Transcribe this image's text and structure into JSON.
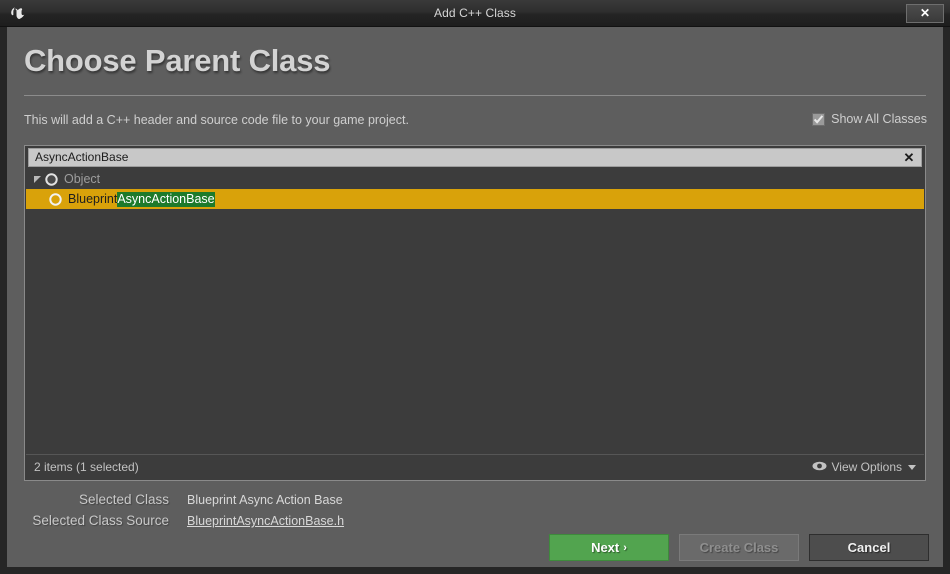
{
  "window": {
    "title": "Add C++ Class",
    "close_label": "✕",
    "logo_icon": "unreal-engine-logo"
  },
  "header": {
    "page_title": "Choose Parent Class",
    "subtitle": "This will add a C++ header and source code file to your game project.",
    "show_all_classes": {
      "label": "Show All Classes",
      "checked": true,
      "check_icon": "checkmark-icon"
    }
  },
  "picker": {
    "search": {
      "value": "AsyncActionBase",
      "placeholder": "Search Classes",
      "clear_label": "✕",
      "clear_icon": "close-icon"
    },
    "tree": [
      {
        "label": "Object",
        "level": 0,
        "expanded": true,
        "selected": false,
        "icon": "class-circle-icon",
        "expander_icon": "triangle-expanded-icon"
      },
      {
        "label_prefix": "Blueprint",
        "label_match": "AsyncActionBase",
        "level": 1,
        "expanded": false,
        "selected": true,
        "icon": "class-circle-icon"
      }
    ],
    "footer": {
      "item_count": "2 items (1 selected)",
      "view_options_label": "View Options",
      "view_options_icon": "eye-icon",
      "caret_icon": "chevron-down-icon"
    }
  },
  "info": {
    "selected_class_label": "Selected Class",
    "selected_class_value": "Blueprint Async Action Base",
    "selected_class_source_label": "Selected Class Source",
    "selected_class_source_value": "BlueprintAsyncActionBase.h"
  },
  "buttons": {
    "next": "Next",
    "next_chevron": "›",
    "create_class": "Create Class",
    "cancel": "Cancel"
  },
  "colors": {
    "selection_orange": "#d9a20a",
    "match_green": "#1d7a2b",
    "next_green": "#52a44f",
    "panel_bg": "#3c3c3c",
    "dialog_bg": "#5e5e5e"
  }
}
